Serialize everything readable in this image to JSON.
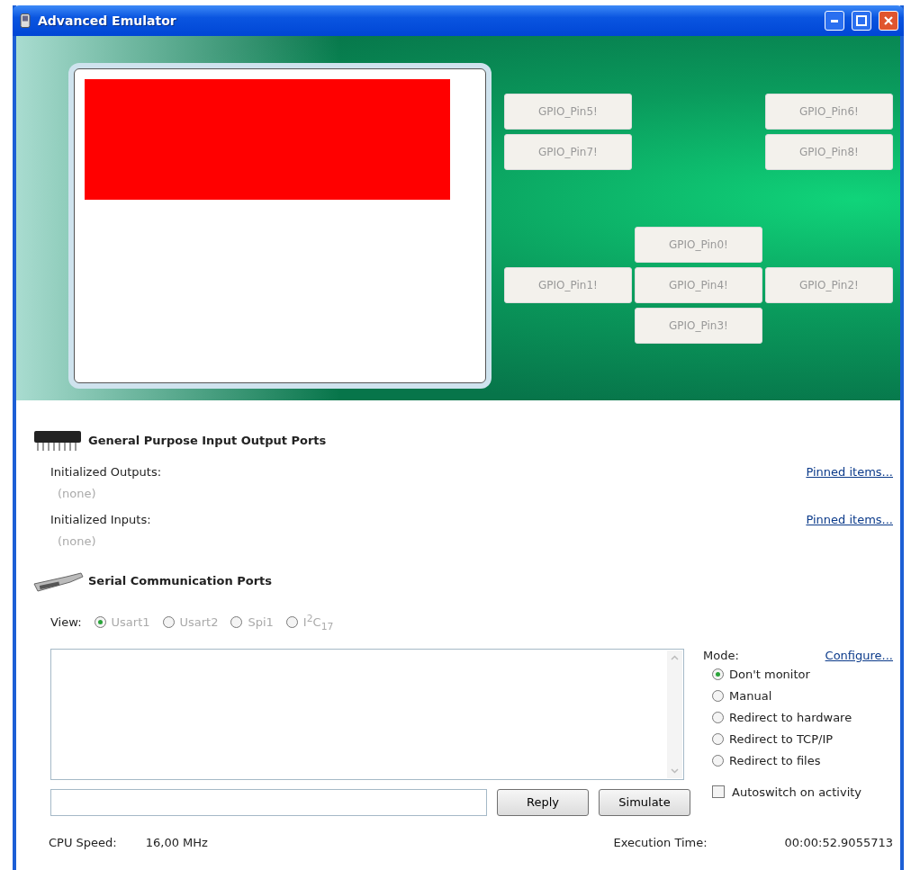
{
  "window": {
    "title": "Advanced Emulator"
  },
  "pins": [
    {
      "label": "GPIO_Pin5!"
    },
    {
      "label": "GPIO_Pin6!"
    },
    {
      "label": "GPIO_Pin7!"
    },
    {
      "label": "GPIO_Pin8!"
    },
    {
      "label": "GPIO_Pin0!"
    },
    {
      "label": "GPIO_Pin1!"
    },
    {
      "label": "GPIO_Pin4!"
    },
    {
      "label": "GPIO_Pin2!"
    },
    {
      "label": "GPIO_Pin3!"
    }
  ],
  "gpio": {
    "title": "General Purpose Input Output Ports",
    "groups": [
      {
        "label": "Initialized Outputs:",
        "value": "(none)",
        "link": "Pinned items..."
      },
      {
        "label": "Initialized Inputs:",
        "value": "(none)",
        "link": "Pinned items..."
      }
    ]
  },
  "serial": {
    "title": "Serial Communication Ports",
    "view_label": "View:",
    "views": [
      {
        "label": "Usart1",
        "selected": true
      },
      {
        "label": "Usart2",
        "selected": false
      },
      {
        "label": "Spi1",
        "selected": false
      },
      {
        "label": "I$^{2}$C$_{17}$",
        "selected": false
      }
    ],
    "mode_label": "Mode:",
    "configure": "Configure...",
    "modes": [
      {
        "label": "Don't monitor",
        "selected": true
      },
      {
        "label": "Manual",
        "selected": false
      },
      {
        "label": "Redirect to hardware",
        "selected": false
      },
      {
        "label": "Redirect to TCP/IP",
        "selected": false
      },
      {
        "label": "Redirect to files",
        "selected": false
      }
    ],
    "buttons": [
      "Reply",
      "Simulate"
    ],
    "autoswitch": {
      "label": "Autoswitch on activity",
      "checked": false
    }
  },
  "status": {
    "cpu_label": "CPU Speed:",
    "cpu_value": "16,00 MHz",
    "time_label": "Execution Time:",
    "time_value": "00:00:52.9055713"
  }
}
